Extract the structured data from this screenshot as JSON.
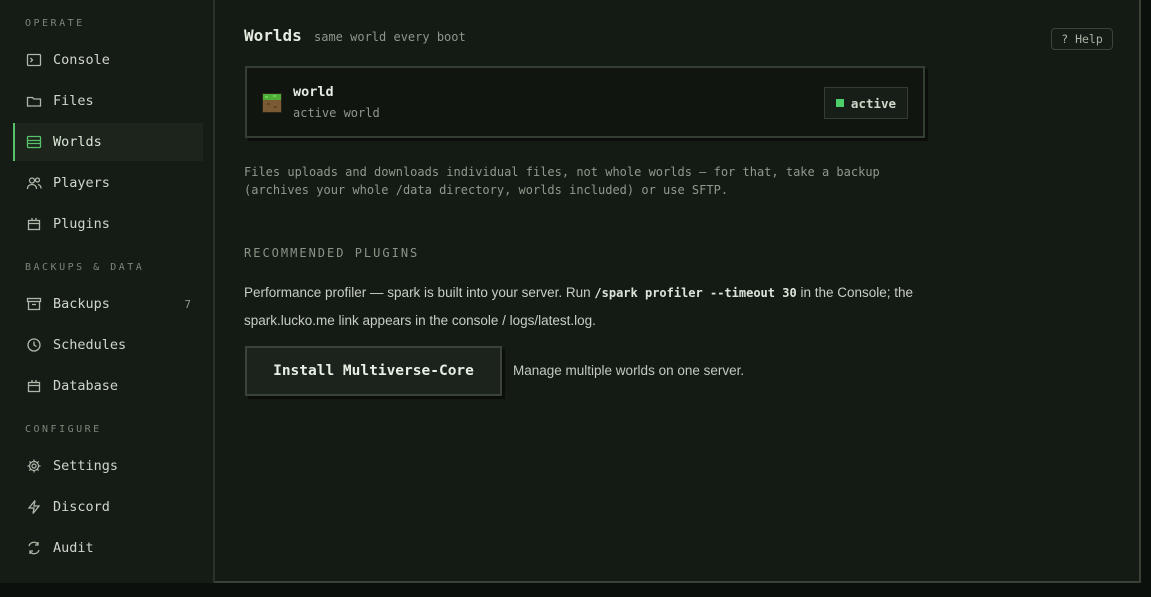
{
  "sidebar": {
    "sections": [
      {
        "label": "OPERATE"
      },
      {
        "label": "BACKUPS & DATA"
      },
      {
        "label": "CONFIGURE"
      }
    ],
    "items": [
      {
        "label": "Console",
        "icon": "console-icon"
      },
      {
        "label": "Files",
        "icon": "folder-icon"
      },
      {
        "label": "Worlds",
        "icon": "worlds-icon",
        "active": true
      },
      {
        "label": "Players",
        "icon": "players-icon"
      },
      {
        "label": "Plugins",
        "icon": "plugins-icon"
      },
      {
        "label": "Backups",
        "icon": "backup-icon",
        "count": "7"
      },
      {
        "label": "Schedules",
        "icon": "clock-icon"
      },
      {
        "label": "Database",
        "icon": "database-icon"
      },
      {
        "label": "Settings",
        "icon": "settings-icon"
      },
      {
        "label": "Discord",
        "icon": "discord-icon"
      },
      {
        "label": "Audit",
        "icon": "audit-icon"
      }
    ]
  },
  "header": {
    "title": "Worlds",
    "subtitle": "same world every boot",
    "help_label": "? Help"
  },
  "world": {
    "name": "world",
    "subtitle": "active world",
    "status": "active",
    "status_color": "#4ccf6a"
  },
  "note": "Files uploads and downloads individual files, not whole worlds — for that, take a backup (archives your whole /data directory, worlds included) or use SFTP.",
  "recommended": {
    "label": "RECOMMENDED PLUGINS",
    "perf_text_1": "Performance profiler — spark is built into your server. Run ",
    "perf_code": "/spark profiler --timeout 30",
    "perf_text_2": " in the Console; the spark.lucko.me link appears in the console / logs/latest.log.",
    "install_label": "Install Multiverse-Core",
    "install_desc": "Manage multiple worlds on one server."
  },
  "colors": {
    "accent": "#56c26a",
    "background": "#141a14"
  }
}
